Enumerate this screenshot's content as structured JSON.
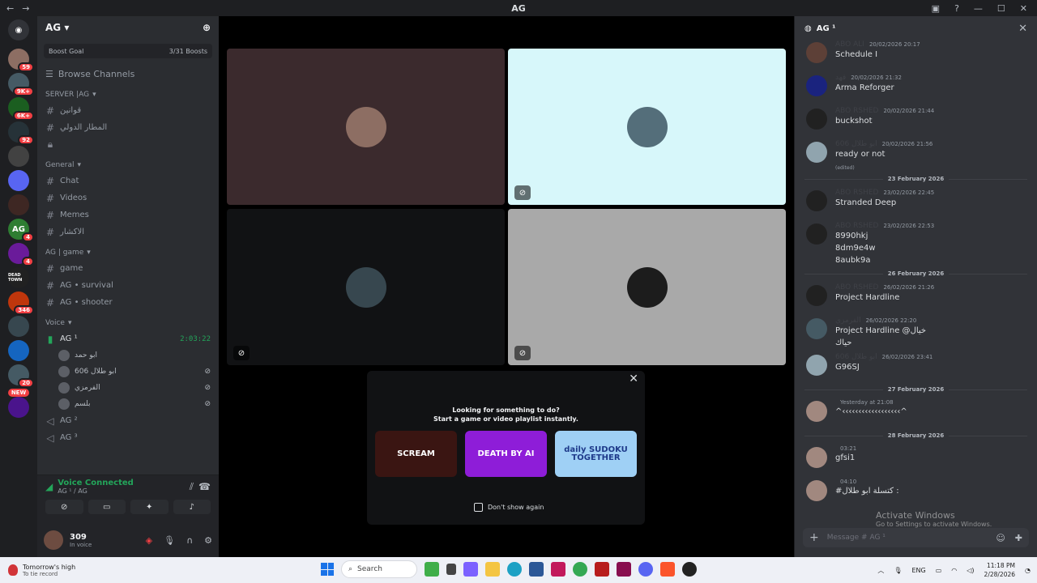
{
  "window": {
    "title": "AG",
    "nav_back": "←",
    "nav_fwd": "→"
  },
  "servers": [
    {
      "badge": "59"
    },
    {
      "badge": "9K+"
    },
    {
      "badge": "6K+"
    },
    {
      "badge": "92"
    },
    {
      "badge": ""
    },
    {
      "badge": ""
    },
    {
      "badge": ""
    },
    {
      "label": "AG",
      "badge": "4"
    },
    {
      "badge": "4"
    },
    {
      "label": "DEAD TOWN",
      "badge": ""
    },
    {
      "badge": "346"
    },
    {
      "badge": ""
    },
    {
      "badge": ""
    },
    {
      "badge": "20"
    },
    {
      "badge": ""
    }
  ],
  "server_new_label": "NEW",
  "guild": {
    "name": "AG",
    "boost_label": "Boost Goal",
    "boost_count": "3/31 Boosts",
    "browse": "Browse Channels"
  },
  "categories": [
    {
      "name": "SERVER |AG",
      "channels": [
        "قوانين",
        "المطار الدولي",
        ""
      ]
    },
    {
      "name": "General",
      "channels": [
        "Chat",
        "Videos",
        "Memes",
        "الاكشار"
      ]
    },
    {
      "name": "AG | game",
      "channels": [
        "game",
        "AG • survival",
        "AG • shooter"
      ]
    }
  ],
  "voice_category": "Voice",
  "voice_channel": {
    "name": "AG ¹",
    "timer": "2:03:22"
  },
  "voice_users": [
    "ابو حمد",
    "ابو طلال 606",
    "الفرمزي",
    "بلسم"
  ],
  "other_voice": [
    "AG ²",
    "AG ³"
  ],
  "voice_panel": {
    "status": "Voice Connected",
    "sub": "AG ¹ / AG"
  },
  "user": {
    "name": "309",
    "status": "In voice"
  },
  "activity": {
    "line1": "Looking for something to do?",
    "line2": "Start a game or video playlist instantly.",
    "cards": [
      "SCREAM",
      "DEATH BY AI",
      "daily SUDOKU TOGETHER"
    ],
    "dont_show": "Don't show again"
  },
  "chat": {
    "title": "AG ¹",
    "messages": [
      {
        "name": "ABO ALI",
        "time": "20/02/2026 20:17",
        "lines": [
          "Schedule I"
        ]
      },
      {
        "name": "فهد",
        "time": "20/02/2026 21:32",
        "lines": [
          "Arma Reforger"
        ]
      },
      {
        "name": "ABO RSHED",
        "time": "20/02/2026 21:44",
        "lines": [
          "buckshot"
        ]
      },
      {
        "name": "ابو طلال 606",
        "time": "20/02/2026 21:56",
        "lines": [
          "ready or not"
        ],
        "edited": "(edited)"
      },
      {
        "separator": "23 February 2026"
      },
      {
        "name": "ABO RSHED",
        "time": "23/02/2026 22:45",
        "lines": [
          "Stranded Deep"
        ]
      },
      {
        "name": "ABO RSHED",
        "time": "23/02/2026 22:53",
        "lines": [
          "8990hkj",
          "8dm9e4w",
          "8aubk9a"
        ]
      },
      {
        "separator": "26 February 2026"
      },
      {
        "name": "ABO RSHED",
        "time": "26/02/2026 21:26",
        "lines": [
          "Project Hardline"
        ]
      },
      {
        "name": "الفرمزي",
        "time": "26/02/2026 22:20",
        "lines": [
          "Project Hardline @خيال",
          "حياك"
        ]
      },
      {
        "name": "ابو طلال 606",
        "time": "26/02/2026 23:41",
        "lines": [
          "G96SJ"
        ]
      },
      {
        "separator": "27 February 2026"
      },
      {
        "name": "",
        "time": "Yesterday at 21:08",
        "lines": [
          "^‹‹‹‹‹‹‹‹‹‹‹‹‹‹‹‹‹‹^"
        ]
      },
      {
        "separator": "28 February 2026"
      },
      {
        "name": "",
        "time": "03:21",
        "lines": [
          "gfsi1"
        ]
      },
      {
        "name": "",
        "time": "04:10",
        "lines": [
          "#كتسلة ابو طلال :"
        ]
      }
    ],
    "composer_placeholder": "Message # AG ¹"
  },
  "watermark": {
    "line1": "Activate Windows",
    "line2": "Go to Settings to activate Windows."
  },
  "taskbar": {
    "weather_l1": "Tomorrow's high",
    "weather_l2": "To tie record",
    "search": "Search",
    "lang": "ENG",
    "time": "11:18 PM",
    "date": "2/28/2026"
  }
}
